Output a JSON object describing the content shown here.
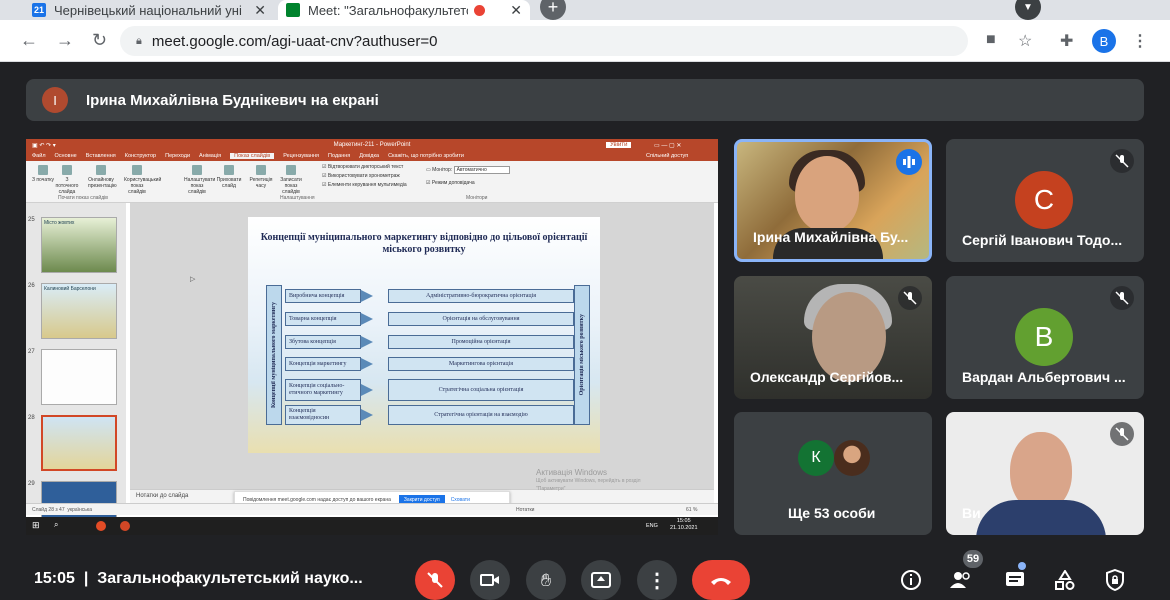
{
  "browser": {
    "tabs": [
      {
        "label": "Чернівецький національний уні",
        "favicon": "21",
        "active": false
      },
      {
        "label": "Meet: \"Загальнофакультетсь",
        "active": true
      }
    ],
    "url": "meet.google.com/agi-uaat-cnv?authuser=0",
    "profile_initial": "B"
  },
  "meet": {
    "presenter_banner": {
      "initial": "І",
      "text": "Ірина Михайлівна Будніквич на екрані"
    },
    "tiles": [
      {
        "name": "Ірина Михайлівна Бу...",
        "speaking": true
      },
      {
        "name": "Сергій Іванович Тодо...",
        "initial": "С",
        "color": "#c5411f",
        "muted": true
      },
      {
        "name": "Олександр Сергійов...",
        "muted": true
      },
      {
        "name": "Вардан Альбертович ...",
        "initial": "В",
        "color": "#62a030",
        "muted": true
      },
      {
        "name": "Ще 53 особи",
        "initial": "К",
        "color": "#137333"
      },
      {
        "name": "Ви",
        "muted": true
      }
    ],
    "bottom": {
      "time": "15:05",
      "separator": "|",
      "meeting_title": "Загальнофакультетський науко...",
      "participants_count": "59"
    }
  },
  "pp": {
    "window_title": "Маркетинг-211 - PowerPoint",
    "sign_in": "Увійти",
    "tabs": [
      "Файл",
      "Основне",
      "Вставлення",
      "Конструктор",
      "Переходи",
      "Анімація",
      "Показ слайдів",
      "Рецензування",
      "Подання",
      "Довідка",
      "Скажіть, що потрібно зробити"
    ],
    "share": "Спільний доступ",
    "ribbon": {
      "b1": "З початку",
      "b2": "З поточного слайда",
      "b3": "Онлайнову презентацію",
      "b4": "Користувацький показ слайдів",
      "b5": "Налаштувати показ слайдів",
      "b6": "Приховати слайд",
      "b7": "Репетиція часу",
      "b8": "Записати показ слайдів",
      "c1": "Відтворювати дикторський текст",
      "c2": "Використовувати хронометраж",
      "c3": "Елементи керування мультимедіа",
      "monitor_label": "Монітор:",
      "monitor_value": "Автоматично",
      "presenter_view": "Режим доповідача",
      "grp1": "Почати показ слайдів",
      "grp2": "Налаштування",
      "grp3": "Монітори"
    },
    "thumb_nums": [
      "25",
      "26",
      "27",
      "28",
      "29"
    ],
    "thumb_titles": [
      "Місто жовтих",
      "Калиновий Барселони",
      "",
      ""
    ],
    "slide": {
      "title": "Концепції муніципального маркетингу відповідно до цільової орієнтації міського розвитку",
      "left_vertical": "Концепції муніципального маркетингу",
      "right_vertical": "Орієнтація міського розвитку",
      "rows": [
        {
          "left": "Виробнича концепція",
          "right": "Адміністративно-бюрократична орієнтація"
        },
        {
          "left": "Товарна концепція",
          "right": "Орієнтація на обслуговування"
        },
        {
          "left": "Збутова концепція",
          "right": "Промоційна орієнтація"
        },
        {
          "left": "Концепція маркетингу",
          "right": "Маркетингова орієнтація"
        },
        {
          "left": "Концепція соціально-етичного маркетингу",
          "right": "Стратегічна соціальна орієнтація"
        },
        {
          "left": "Концепція взаємовідносин",
          "right": "Стратегічна орієнтація на взаємодію"
        }
      ]
    },
    "notes": "Нотатки до слайда",
    "share_notice": "Повідомлення meet.google.com надає доступ до вашого екрана",
    "share_stop": "Закрити доступ",
    "share_hide": "Сховати",
    "activate_windows_1": "Активація Windows",
    "activate_windows_2": "Щоб активувати Windows, перейдіть в розділ",
    "activate_windows_3": "\"Параметри\"",
    "status": "Слайд 28 з 47",
    "status_lang": "українська",
    "status_notes": "Нотатки",
    "zoom": "61 %",
    "clock_time": "15:05",
    "clock_date": "21.10.2021",
    "lang": "ENG"
  }
}
